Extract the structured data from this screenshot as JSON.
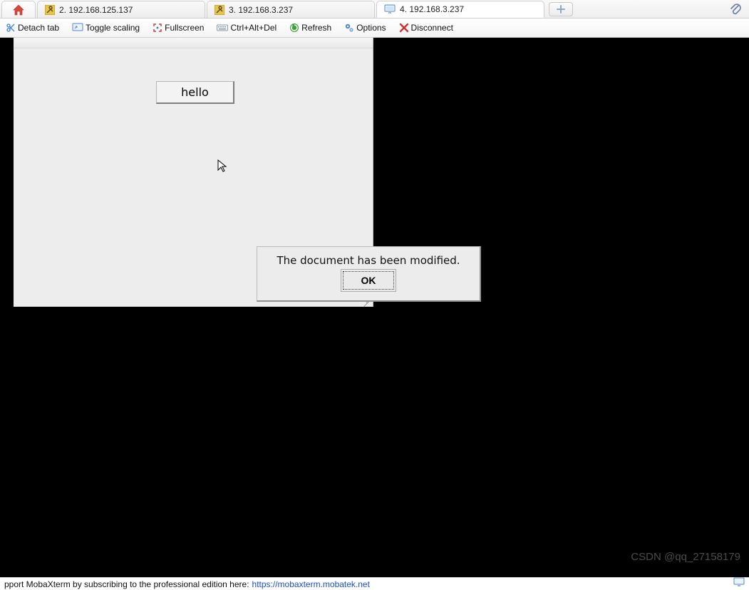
{
  "tabs": {
    "items": [
      {
        "icon": "wrench-icon",
        "label": "2. 192.168.125.137"
      },
      {
        "icon": "wrench-icon",
        "label": "3. 192.168.3.237"
      },
      {
        "icon": "monitor-icon",
        "label": "4. 192.168.3.237"
      }
    ],
    "active_index": 2,
    "plus_tooltip": "New tab"
  },
  "toolbar": {
    "detach_tab": "Detach tab",
    "toggle_scaling": "Toggle scaling",
    "fullscreen": "Fullscreen",
    "ctrl_alt_del": "Ctrl+Alt+Del",
    "refresh": "Refresh",
    "options": "Options",
    "disconnect": "Disconnect"
  },
  "remote": {
    "hello_button": "hello",
    "dialog": {
      "message": "The document has been modified.",
      "ok": "OK"
    }
  },
  "watermark": "CSDN @qq_27158179",
  "statusbar": {
    "text_left": "pport MobaXterm by subscribing to the professional edition here:",
    "link_text": "https://mobaxterm.mobatek.net"
  },
  "colors": {
    "accent_blue": "#1a4fd0",
    "danger_red": "#d12f2f",
    "refresh_green": "#3ba23b"
  }
}
